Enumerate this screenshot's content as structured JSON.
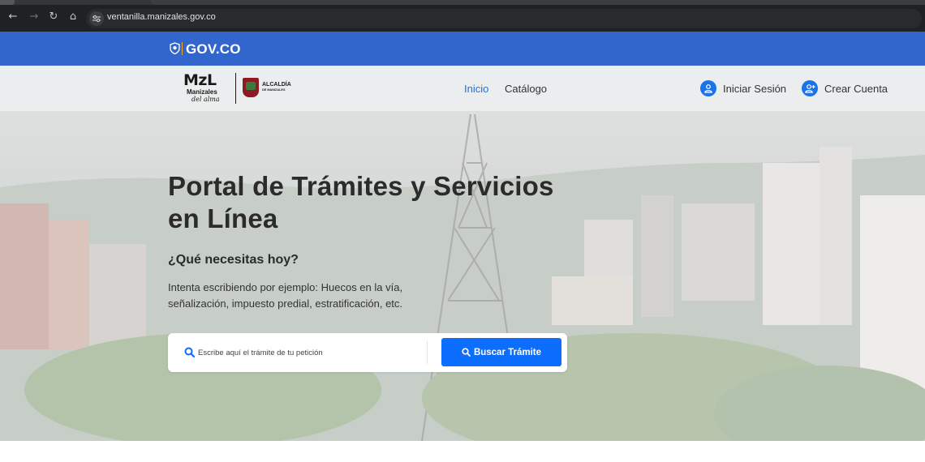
{
  "browser": {
    "url": "ventanilla.manizales.gov.co"
  },
  "gov_bar": {
    "brand_text": "GOV.CO"
  },
  "header": {
    "logo": {
      "primary": "MzL",
      "sub1": "Manizales",
      "sub2": "del alma",
      "alcaldia_line1": "ALCALDÍA",
      "alcaldia_line2": "DE MANIZALES"
    },
    "nav": [
      {
        "label": "Inicio",
        "active": true
      },
      {
        "label": "Catálogo",
        "active": false
      }
    ],
    "login_label": "Iniciar Sesión",
    "register_label": "Crear Cuenta"
  },
  "hero": {
    "title_line1": "Portal de Trámites y Servicios",
    "title_line2": "en Línea",
    "subtitle": "¿Qué necesitas hoy?",
    "hint_line1": "Intenta escribiendo por ejemplo: Huecos en la vía,",
    "hint_line2": "señalización, impuesto predial, estratificación, etc."
  },
  "search": {
    "placeholder": "Escribe aquí el trámite de tu petición",
    "value": "",
    "button_label": "Buscar Trámite"
  },
  "colors": {
    "gov_blue": "#3366cc",
    "accent_blue": "#1a73e8",
    "button_blue": "#0d6efd"
  }
}
